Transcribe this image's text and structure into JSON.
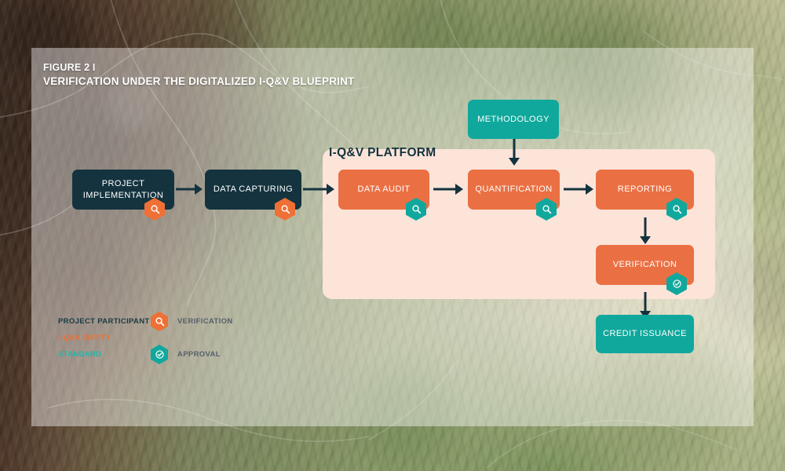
{
  "figure": {
    "number": "FIGURE 2 I",
    "title": "VERIFICATION UNDER THE DIGITALIZED I-Q&V BLUEPRINT"
  },
  "colors": {
    "dark_navy": "#14333F",
    "orange": "#EA7043",
    "teal": "#10A89C",
    "panel_peach": "#FCE4D9",
    "card_overlay": "rgba(255,255,255,0.42)"
  },
  "platform": {
    "label": "I-Q&V PLATFORM"
  },
  "nodes": {
    "project_implementation": {
      "label": "PROJECT IMPLEMENTATION",
      "group": "project-participant",
      "badge": "verification"
    },
    "data_capturing": {
      "label": "DATA CAPTURING",
      "group": "project-participant",
      "badge": "verification"
    },
    "data_audit": {
      "label": "DATA AUDIT",
      "group": "i-q&v-entity",
      "badge": "approval-search"
    },
    "quantification": {
      "label": "QUANTIFICATION",
      "group": "i-q&v-entity",
      "badge": "approval-search"
    },
    "reporting": {
      "label": "REPORTING",
      "group": "i-q&v-entity",
      "badge": "approval-search"
    },
    "verification": {
      "label": "VERIFICATION",
      "group": "i-q&v-entity",
      "badge": "approval-check"
    },
    "methodology": {
      "label": "METHODOLOGY",
      "group": "standard"
    },
    "credit_issuance": {
      "label": "CREDIT ISSUANCE",
      "group": "standard"
    }
  },
  "legend": {
    "keys": [
      {
        "label": "PROJECT PARTICIPANT",
        "color": "#193A46"
      },
      {
        "label": "I-Q&V ENTITY",
        "color": "#EF7035"
      },
      {
        "label": "STANDARD",
        "color": "#19B9AD"
      }
    ],
    "icons": [
      {
        "label": "VERIFICATION",
        "icon": "search-hexagon-icon",
        "color": "#EF7035"
      },
      {
        "label": "APPROVAL",
        "icon": "check-hexagon-icon",
        "color": "#10A89C"
      }
    ]
  }
}
